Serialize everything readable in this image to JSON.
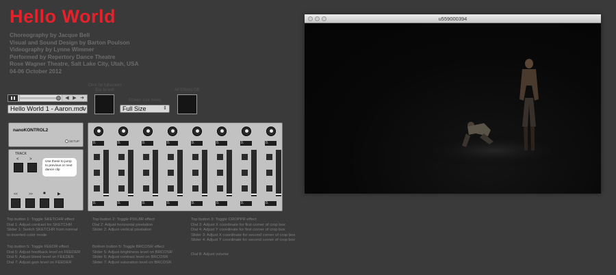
{
  "title": "Hello World",
  "credits": [
    "Choreography by Jacque Bell",
    "Visual and Sound Design by Barton Poulson",
    "Videography by Lynne Wimmer",
    "Performed by Repertory Dance Theatre",
    "Rose Wagner Theatre, Salt Lake City, Utah, USA",
    "04-06 October 2012"
  ],
  "transport": {
    "progress": 0.97
  },
  "file_select": {
    "value": "Hello World 1 - Aaron.mov"
  },
  "fullscreen": {
    "caption_line1": "Click for fullscreen",
    "caption_line2": "Esc to exit"
  },
  "size_menu": {
    "caption": "Screen size menu",
    "value": "Full Size"
  },
  "effects_off": {
    "caption": "All Effects Off"
  },
  "nanokontrol": {
    "title": "nanoKONTROL2",
    "setup_label": "SETUP",
    "track_label": "TRACK",
    "prev_label": "<",
    "next_label": ">",
    "tooltip": "Use these to jump to previous or next dance clip",
    "rewind_label": "<<",
    "ff_label": ">>",
    "stop_label": "■",
    "play_label": "▶",
    "channels": [
      {
        "dial_value": "0.",
        "slider_value": "0."
      },
      {
        "dial_value": "0.",
        "slider_value": "0."
      },
      {
        "dial_value": "0.",
        "slider_value": "0."
      },
      {
        "dial_value": "0.",
        "slider_value": "0."
      },
      {
        "dial_value": "0.",
        "slider_value": "0."
      },
      {
        "dial_value": "0.",
        "slider_value": "0."
      },
      {
        "dial_value": "0.",
        "slider_value": "0."
      },
      {
        "dial_value": "0.",
        "slider_value": "0."
      }
    ]
  },
  "help": {
    "col1a": [
      "Top button 1: Toggle SKETCHR effect",
      "Dial 1: Adjust contrast for SKETCHR",
      "Slider 1: Switch SKETCHR from normal",
      "to inverted color mode"
    ],
    "col2a": [
      "Top button 2: Toggle PIXL8R effect",
      "Dial 2: Adjust horizontal pixelation",
      "Slider 2: Adjust vertical pixelation"
    ],
    "col3a": [
      "Top button 3: Toggle CROPPR effect",
      "Dial 3: Adjust X coordinate for first corner of crop box",
      "Dial 4: Adjust Y coordinate for first corner of crop box",
      "Slider 3: Adjust X coordinate for second corner of crop box",
      "Slider 4: Adjust Y coordinate for second corner of crop box"
    ],
    "col1b": [
      "Top button 5: Toggle FEEDR effect",
      "Dial 5: Adjust feedback level on FEEDER",
      "Dial 6: Adjust bleed level on FEEDER",
      "Dial 7: Adjust gain level on FEEDER"
    ],
    "col2b": [
      "Bottom button 5: Toggle BRCOSR effect",
      "Slider 5: Adjust brightness level on BRCOSR",
      "Slider 6: Adjust contrast level on BRCOSR",
      "Slider 7: Adjust saturation level on BRCOSR"
    ],
    "col3b": [
      "Dial 8: Adjust volume"
    ]
  },
  "video": {
    "window_title": "u559000394"
  }
}
